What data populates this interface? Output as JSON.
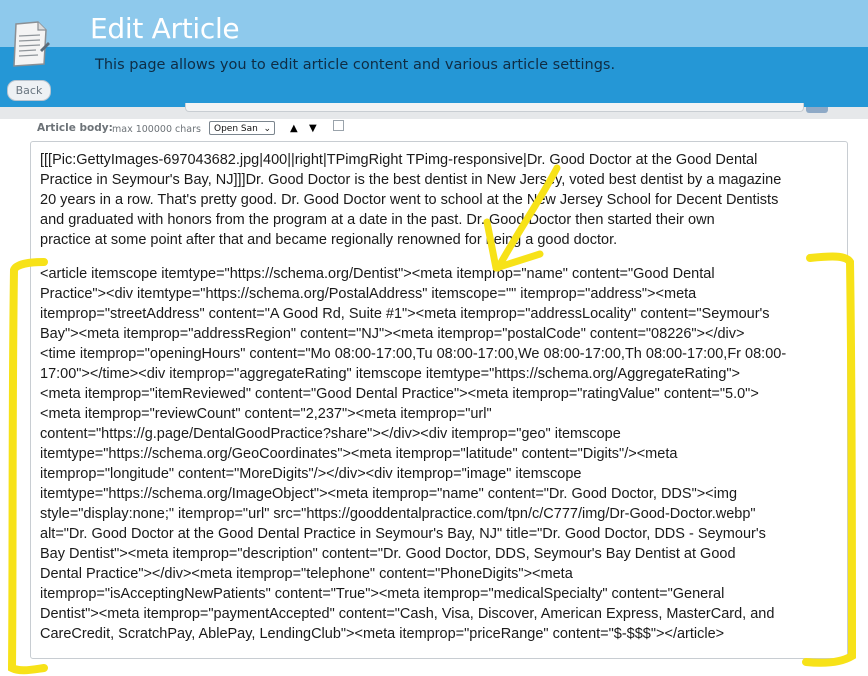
{
  "header": {
    "title": "Edit Article",
    "description": "This page allows you to edit article content and various article settings.",
    "back_label": "Back",
    "icon": "document-edit-icon"
  },
  "toolbar": {
    "label": "Article body:",
    "max_chars": "max 100000 chars",
    "font_value": "Open San",
    "up_glyph": "▲",
    "down_glyph": "▼"
  },
  "editor": {
    "lines": [
      "[[[Pic:GettyImages-697043682.jpg|400||right|TPimgRight TPimg-responsive|Dr. Good Doctor at the Good Dental",
      "Practice in Seymour's Bay, NJ]]]Dr. Good Doctor is the best dentist in New Jersey, voted best dentist by a magazine",
      "20 years in a row. That's pretty good. Dr. Good Doctor went to school at the New Jersey School for Decent Dentists",
      "and graduated with honors from the program at a date in the past. Dr. Good Doctor then started their own",
      "practice at some point after that and became regionally renowned for being a good doctor.",
      "",
      "<article itemscope itemtype=\"https://schema.org/Dentist\"><meta itemprop=\"name\" content=\"Good Dental",
      "Practice\"><div itemtype=\"https://schema.org/PostalAddress\" itemscope=\"\" itemprop=\"address\"><meta",
      "itemprop=\"streetAddress\" content=\"A Good Rd, Suite #1\"><meta itemprop=\"addressLocality\" content=\"Seymour's",
      "Bay\"><meta itemprop=\"addressRegion\" content=\"NJ\"><meta itemprop=\"postalCode\" content=\"08226\"></div>",
      "<time itemprop=\"openingHours\" content=\"Mo 08:00-17:00,Tu 08:00-17:00,We 08:00-17:00,Th 08:00-17:00,Fr 08:00-",
      "17:00\"></time><div itemprop=\"aggregateRating\" itemscope itemtype=\"https://schema.org/AggregateRating\">",
      "<meta itemprop=\"itemReviewed\" content=\"Good Dental Practice\"><meta itemprop=\"ratingValue\" content=\"5.0\">",
      "<meta itemprop=\"reviewCount\" content=\"2,237\"><meta itemprop=\"url\"",
      "content=\"https://g.page/DentalGoodPractice?share\"></div><div itemprop=\"geo\" itemscope",
      "itemtype=\"https://schema.org/GeoCoordinates\"><meta itemprop=\"latitude\" content=\"Digits\"/><meta",
      "itemprop=\"longitude\" content=\"MoreDigits\"/></div><div itemprop=\"image\" itemscope",
      "itemtype=\"https://schema.org/ImageObject\"><meta itemprop=\"name\" content=\"Dr. Good Doctor, DDS\"><img",
      "style=\"display:none;\" itemprop=\"url\" src=\"https://gooddentalpractice.com/tpn/c/C777/img/Dr-Good-Doctor.webp\"",
      "alt=\"Dr. Good Doctor at the Good Dental Practice in Seymour's Bay, NJ\" title=\"Dr. Good Doctor, DDS - Seymour's",
      "Bay Dentist\"><meta itemprop=\"description\" content=\"Dr. Good Doctor, DDS, Seymour's Bay Dentist at Good",
      "Dental Practice\"></div><meta itemprop=\"telephone\" content=\"PhoneDigits\"><meta",
      "itemprop=\"isAcceptingNewPatients\" content=\"True\"><meta itemprop=\"medicalSpecialty\" content=\"General",
      "Dentist\"><meta itemprop=\"paymentAccepted\" content=\"Cash, Visa, Discover, American Express, MasterCard, and",
      "CareCredit, ScratchPay, AblePay, LendingClub\"><meta itemprop=\"priceRange\" content=\"$-$$$\"></article>"
    ]
  },
  "annotation_colors": {
    "highlight": "#f7e218"
  }
}
